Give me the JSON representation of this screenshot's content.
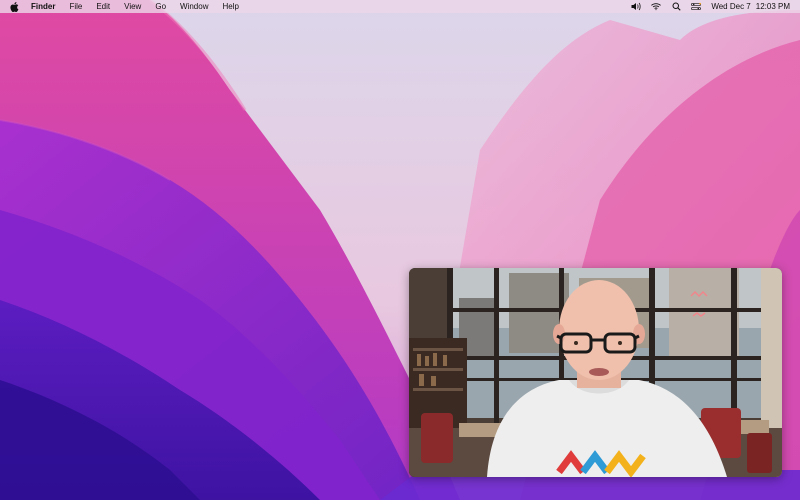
{
  "menubar": {
    "apple_icon": "apple-logo-icon",
    "app_name": "Finder",
    "menus": [
      "File",
      "Edit",
      "View",
      "Go",
      "Window",
      "Help"
    ],
    "status_icons": [
      "volume-icon",
      "wifi-icon",
      "spotlight-search-icon",
      "control-center-icon"
    ],
    "date": "Wed Dec 7",
    "time": "12:03 PM"
  },
  "desktop": {
    "wallpaper": "macOS Monterey wallpaper",
    "colors": {
      "sky": "#e4d8e8",
      "pink": "#e04aa2",
      "magenta": "#b42cc4",
      "purple": "#7a22c8",
      "deep_blue": "#3c14a8"
    }
  },
  "pip_window": {
    "content": "video-frame",
    "shirt_logo_colors": [
      "#e03c3c",
      "#2e9bd6",
      "#f3b21b"
    ]
  }
}
